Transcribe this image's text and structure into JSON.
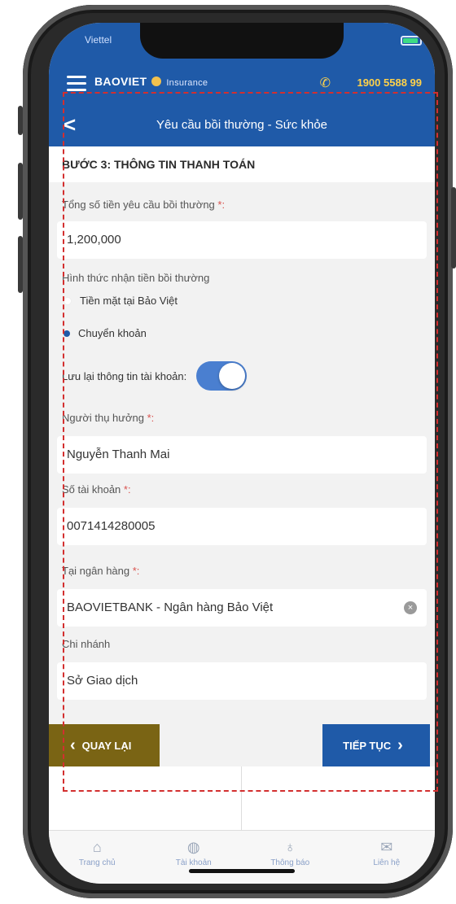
{
  "status": {
    "left": "Viettel"
  },
  "header": {
    "brand": "BAOVIET",
    "brand_sub": "Insurance",
    "hotline": "1900 5588 99"
  },
  "nav": {
    "back_symbol": "<",
    "title": "Yêu cầu bồi thường - Sức khỏe"
  },
  "step": {
    "title": "BƯỚC 3: THÔNG TIN THANH TOÁN"
  },
  "form": {
    "total_label": "Tổng số tiền yêu cầu bồi thường",
    "total_value": "1,200,000",
    "method_label": "Hình thức nhận tiền bồi thường",
    "method_options": [
      "Tiền mặt tại Bảo Việt",
      "Chuyển khoản"
    ],
    "selected_method": "Chuyển khoản",
    "save_label": "Lưu lại thông tin tài khoản:",
    "save_toggle": true,
    "beneficiary_label": "Người thụ hưởng",
    "beneficiary_value": "Nguyễn Thanh Mai",
    "account_label": "Số tài khoản",
    "account_value": "0071414280005",
    "bank_label": "Tại ngân hàng",
    "bank_value": "BAOVIETBANK - Ngân hàng Bảo Việt",
    "branch_label": "Chi nhánh",
    "branch_value": "Sở Giao dịch",
    "required_mark": "*:"
  },
  "buttons": {
    "back": "QUAY LẠI",
    "next": "TIẾP TỤC"
  },
  "tabs": [
    {
      "label": "Trang chủ",
      "icon": "home-icon"
    },
    {
      "label": "Tài khoản",
      "icon": "account-icon"
    },
    {
      "label": "Thông báo",
      "icon": "bell-icon"
    },
    {
      "label": "Liên hệ",
      "icon": "mail-icon"
    }
  ],
  "colors": {
    "primary": "#1f5aa8",
    "back_button": "#7a6414",
    "accent": "#ffd24a",
    "highlight_border": "#d32f2f"
  }
}
